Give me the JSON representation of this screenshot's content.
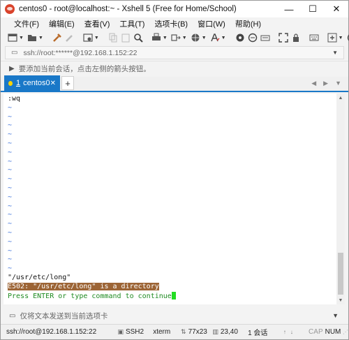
{
  "window": {
    "title": "centos0 - root@localhost:~ - Xshell 5 (Free for Home/School)",
    "controls": [
      "—",
      "☐",
      "✕"
    ]
  },
  "menu": [
    "文件(F)",
    "编辑(E)",
    "查看(V)",
    "工具(T)",
    "选项卡(B)",
    "窗口(W)",
    "帮助(H)"
  ],
  "toolbar_icons": [
    "new-session-icon",
    "open-folder-icon",
    "connect-icon",
    "disconnect-icon",
    "properties-icon",
    "copy-icon",
    "paste-icon",
    "find-icon",
    "print-icon",
    "transfer-icon",
    "globe-icon",
    "font-icon",
    "script-icon",
    "compose-icon",
    "keyboard-icon",
    "fullscreen-icon",
    "lock-icon",
    "keymap-icon",
    "add-icon",
    "help-icon"
  ],
  "address": {
    "text": "ssh://root:******@192.168.1.152:22"
  },
  "hint": {
    "text": "要添加当前会话，点击左侧的箭头按钮。"
  },
  "tabs": {
    "active": {
      "number": "1",
      "label": "centos0"
    },
    "add_label": "+"
  },
  "terminal": {
    "first_line": ":wq",
    "tilde_char": "~",
    "tilde_count": 19,
    "file_line": "\"/usr/etc/long\"",
    "error_line": "E502: \"/usr/etc/long\" is a directory",
    "prompt_line": "Press ENTER or type command to continue"
  },
  "compose": {
    "text": "仅将文本发送到当前选项卡"
  },
  "status": {
    "connection": "ssh://root@192.168.1.152:22",
    "protocol": "SSH2",
    "terminal_type": "xterm",
    "size": "77x23",
    "position": "23,40",
    "sessions": "1 会话",
    "caps": "CAP",
    "num": "NUM"
  },
  "colors": {
    "accent": "#1978c8",
    "error_bg": "#9c6435",
    "prompt": "#1f8b22",
    "tilde": "#3a6fd8",
    "cursor": "#22dd22"
  }
}
